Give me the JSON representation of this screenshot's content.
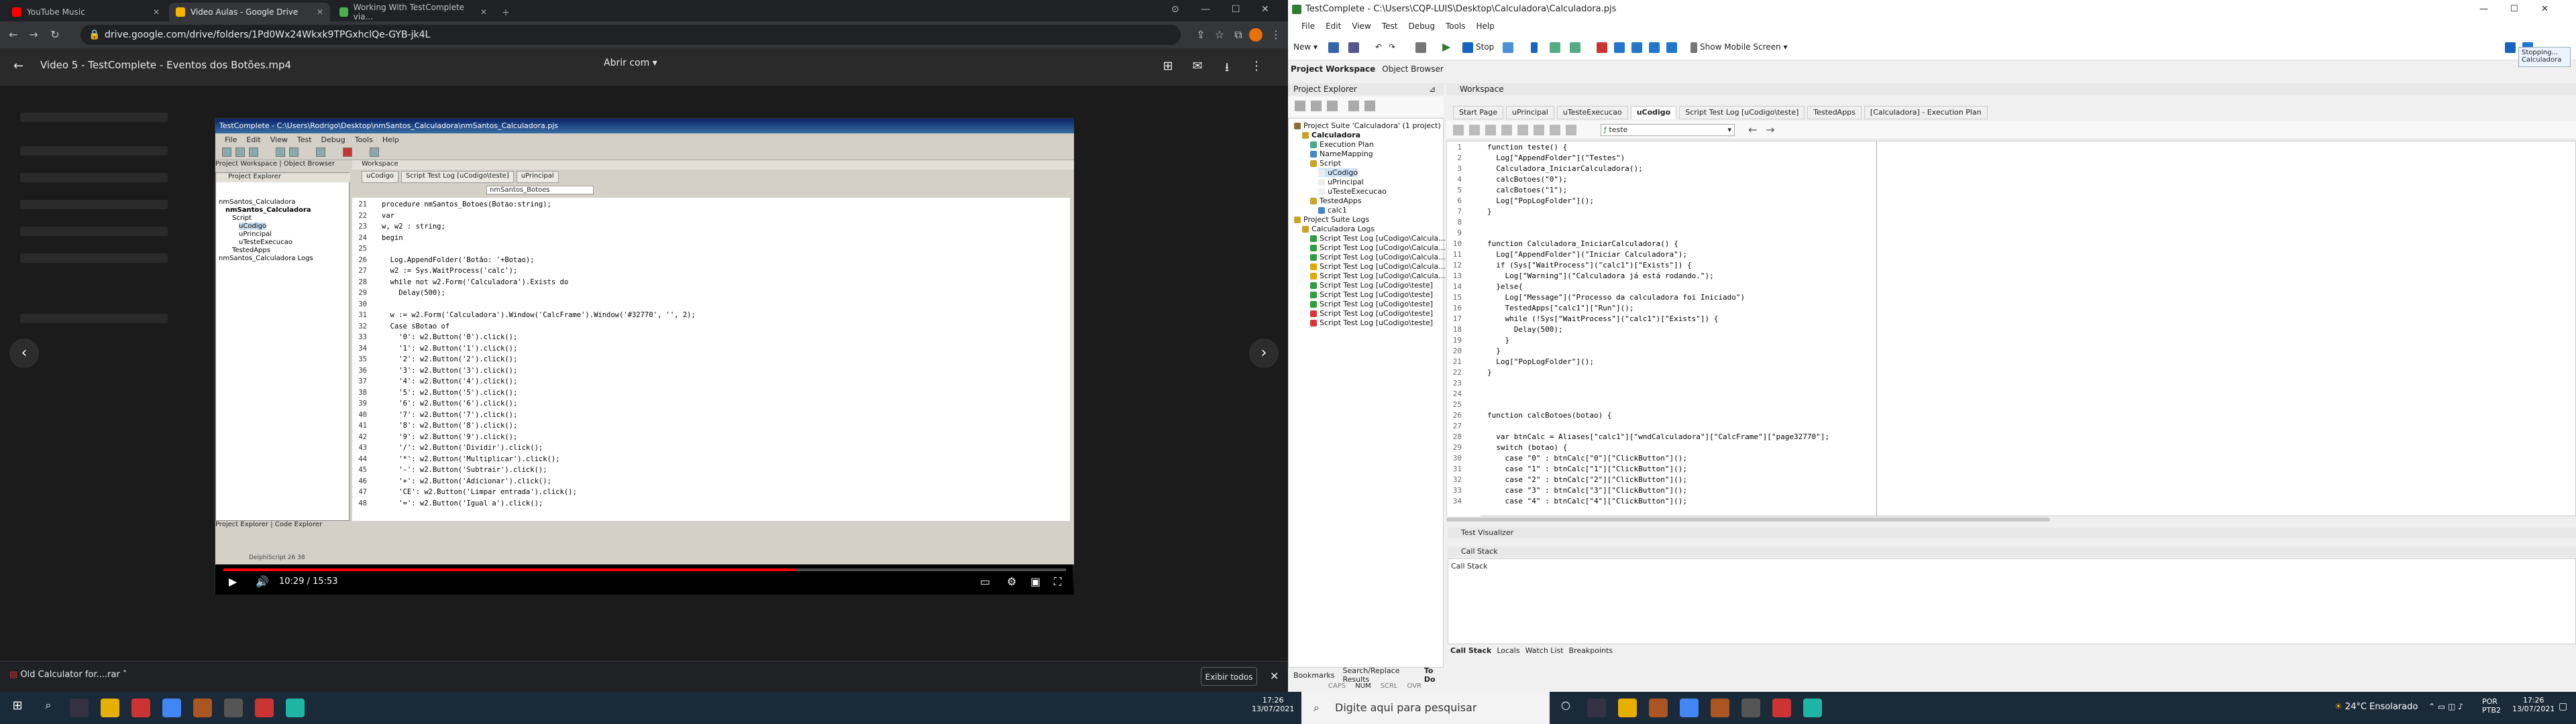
{
  "chrome": {
    "tabs": [
      {
        "label": "YouTube Music",
        "color": "#ff0000"
      },
      {
        "label": "Video Aulas - Google Drive",
        "color": "#f4b400"
      },
      {
        "label": "Working With TestComplete via...",
        "color": "#4caf50"
      }
    ],
    "address": "drive.google.com/drive/folders/1Pd0Wx24Wkxk9TPGxhclQe-GYB-jk4L",
    "video_title": "Video 5 - TestComplete - Eventos dos Botões.mp4",
    "open_with": "Abrir com"
  },
  "video": {
    "app_title": "TestComplete - C:\\Users\\Rodrigo\\Desktop\\nmSantos_Calculadora\\nmSantos_Calculadora.pjs",
    "menu": [
      "File",
      "Edit",
      "View",
      "Test",
      "Debug",
      "Tools",
      "Help"
    ],
    "left_tabs": [
      "Project Workspace",
      "Object Browser"
    ],
    "explorer_title": "Project Explorer",
    "tree": [
      "nmSantos_Calculadora",
      "nmSantos_Calculadora",
      "Script",
      "uCodigo",
      "uPrincipal",
      "uTesteExecucao",
      "TestedApps",
      "nmSantos_Calculadora Logs"
    ],
    "workspace_title": "Workspace",
    "tabs": [
      "uCodigo",
      "Script Test Log [uCodigo\\teste]",
      "uPrincipal"
    ],
    "routine": "nmSantos_Botoes",
    "code": [
      {
        "n": "21",
        "t": "procedure nmSantos_Botoes(Botao:string);"
      },
      {
        "n": "22",
        "t": "var"
      },
      {
        "n": "23",
        "t": "w, w2 : string;"
      },
      {
        "n": "24",
        "t": "begin"
      },
      {
        "n": "25",
        "t": ""
      },
      {
        "n": "26",
        "t": "  Log.AppendFolder('Botão: '+Botao);"
      },
      {
        "n": "27",
        "t": "  w2 := Sys.WaitProcess('calc');"
      },
      {
        "n": "28",
        "t": "  while not w2.Form('Calculadora').Exists do"
      },
      {
        "n": "29",
        "t": "    Delay(500);"
      },
      {
        "n": "30",
        "t": ""
      },
      {
        "n": "31",
        "t": "  w := w2.Form('Calculadora').Window('CalcFrame').Window('#32770', '', 2);"
      },
      {
        "n": "32",
        "t": "  Case sBotao of"
      },
      {
        "n": "33",
        "t": "    '0': w2.Button('0').click();"
      },
      {
        "n": "34",
        "t": "    '1': w2.Button('1').click();"
      },
      {
        "n": "35",
        "t": "    '2': w2.Button('2').click();"
      },
      {
        "n": "36",
        "t": "    '3': w2.Button('3').click();"
      },
      {
        "n": "37",
        "t": "    '4': w2.Button('4').click();"
      },
      {
        "n": "38",
        "t": "    '5': w2.Button('5').click();"
      },
      {
        "n": "39",
        "t": "    '6': w2.Button('6').click();"
      },
      {
        "n": "40",
        "t": "    '7': w2.Button('7').click();"
      },
      {
        "n": "41",
        "t": "    '8': w2.Button('8').click();"
      },
      {
        "n": "42",
        "t": "    '9': w2.Button('9').click();"
      },
      {
        "n": "43",
        "t": "    '/': w2.Button('Dividir').click();"
      },
      {
        "n": "44",
        "t": "    '*': w2.Button('Multiplicar').click();"
      },
      {
        "n": "45",
        "t": "    '-': w2.Button('Subtrair').click();"
      },
      {
        "n": "46",
        "t": "    '+': w2.Button('Adicionar').click();"
      },
      {
        "n": "47",
        "t": "    'CE': w2.Button('Limpar entrada').click();"
      },
      {
        "n": "48",
        "t": "    '=': w2.Button('Igual a').click();"
      }
    ],
    "bottom_tabs": [
      "Project Explorer",
      "Code Explorer"
    ],
    "status": "DelphiScript   26   38",
    "time": "10:29 / 15:53",
    "progress": 0.68
  },
  "download": {
    "file": "Old Calculator for....rar",
    "show_all": "Exibir todos"
  },
  "tc": {
    "title": "TestComplete - C:\\Users\\CQP-LUIS\\Desktop\\Calculadora\\Calculadora.pjs",
    "menu": [
      "File",
      "Edit",
      "View",
      "Test",
      "Debug",
      "Tools",
      "Help"
    ],
    "toolbar": {
      "new": "New",
      "stop": "Stop",
      "mobile": "Show Mobile Screen"
    },
    "subtabs": [
      "Project Workspace",
      "Object Browser"
    ],
    "explorer_title": "Project Explorer",
    "tree": [
      {
        "label": "Project Suite 'Calculadora' (1 project)",
        "lvl": 0,
        "c": "#8a6d3b"
      },
      {
        "label": "Calculadora",
        "lvl": 1,
        "c": "#c9a227",
        "b": true
      },
      {
        "label": "Execution Plan",
        "lvl": 2,
        "c": "#4a8"
      },
      {
        "label": "NameMapping",
        "lvl": 2,
        "c": "#48c"
      },
      {
        "label": "Script",
        "lvl": 2,
        "c": "#c9a227"
      },
      {
        "label": "uCodigo",
        "lvl": 3,
        "c": "#eee",
        "sel": true
      },
      {
        "label": "uPrincipal",
        "lvl": 3,
        "c": "#eee"
      },
      {
        "label": "uTesteExecucao",
        "lvl": 3,
        "c": "#eee"
      },
      {
        "label": "TestedApps",
        "lvl": 2,
        "c": "#c9a227"
      },
      {
        "label": "calc1",
        "lvl": 3,
        "c": "#48c"
      },
      {
        "label": "Project Suite Logs",
        "lvl": 0,
        "c": "#c9a227"
      },
      {
        "label": "Calculadora Logs",
        "lvl": 1,
        "c": "#c9a227"
      },
      {
        "label": "Script Test Log [uCodigo\\Calcula...",
        "lvl": 2,
        "c": "#2e9e3e"
      },
      {
        "label": "Script Test Log [uCodigo\\Calcula...",
        "lvl": 2,
        "c": "#2e9e3e"
      },
      {
        "label": "Script Test Log [uCodigo\\Calcula...",
        "lvl": 2,
        "c": "#2e9e3e"
      },
      {
        "label": "Script Test Log [uCodigo\\Calcula...",
        "lvl": 2,
        "c": "#e0a800"
      },
      {
        "label": "Script Test Log [uCodigo\\Calcula...",
        "lvl": 2,
        "c": "#e0a800"
      },
      {
        "label": "Script Test Log [uCodigo\\teste]",
        "lvl": 2,
        "c": "#2e9e3e"
      },
      {
        "label": "Script Test Log [uCodigo\\teste]",
        "lvl": 2,
        "c": "#2e9e3e"
      },
      {
        "label": "Script Test Log [uCodigo\\teste]",
        "lvl": 2,
        "c": "#2e9e3e"
      },
      {
        "label": "Script Test Log [uCodigo\\teste]",
        "lvl": 2,
        "c": "#d33"
      },
      {
        "label": "Script Test Log [uCodigo\\teste]",
        "lvl": 2,
        "c": "#d33"
      }
    ],
    "explorer_bottom": [
      "Bookmarks",
      "Search/Replace Results",
      "To Do"
    ],
    "workspace_title": "Workspace",
    "tabs": [
      "Start Page",
      "uPrincipal",
      "uTesteExecucao",
      "uCodigo",
      "Script Test Log [uCodigo\\teste]",
      "TestedApps",
      "[Calculadora] - Execution Plan"
    ],
    "active_tab": 3,
    "routine": "teste",
    "code": [
      {
        "n": "1",
        "t": "function teste() {"
      },
      {
        "n": "2",
        "t": "  Log[\"AppendFolder\"](\"Testes\")"
      },
      {
        "n": "3",
        "t": "  Calculadora_IniciarCalculadora();"
      },
      {
        "n": "4",
        "t": "  calcBotoes(\"0\");"
      },
      {
        "n": "5",
        "t": "  calcBotoes(\"1\");"
      },
      {
        "n": "6",
        "t": "  Log[\"PopLogFolder\"]();"
      },
      {
        "n": "7",
        "t": "}"
      },
      {
        "n": "8",
        "t": ""
      },
      {
        "n": "9",
        "t": ""
      },
      {
        "n": "10",
        "t": "function Calculadora_IniciarCalculadora() {"
      },
      {
        "n": "11",
        "t": "  Log[\"AppendFolder\"](\"Iniciar Calculadora\");"
      },
      {
        "n": "12",
        "t": "  if (Sys[\"WaitProcess\"](\"calc1\")[\"Exists\"]) {"
      },
      {
        "n": "13",
        "t": "    Log[\"Warning\"](\"Calculadora já está rodando.\");"
      },
      {
        "n": "14",
        "t": "  }else{"
      },
      {
        "n": "15",
        "t": "    Log[\"Message\"](\"Processo da calculadora foi Iniciado\")"
      },
      {
        "n": "16",
        "t": "    TestedApps[\"calc1\"][\"Run\"]();"
      },
      {
        "n": "17",
        "t": "    while (!Sys[\"WaitProcess\"](\"calc1\")[\"Exists\"]) {"
      },
      {
        "n": "18",
        "t": "      Delay(500);"
      },
      {
        "n": "19",
        "t": "    }"
      },
      {
        "n": "20",
        "t": "  }"
      },
      {
        "n": "21",
        "t": "  Log[\"PopLogFolder\"]();"
      },
      {
        "n": "22",
        "t": "}"
      },
      {
        "n": "23",
        "t": ""
      },
      {
        "n": "24",
        "t": ""
      },
      {
        "n": "25",
        "t": ""
      },
      {
        "n": "26",
        "t": "function calcBotoes(botao) {"
      },
      {
        "n": "27",
        "t": ""
      },
      {
        "n": "28",
        "t": "  var btnCalc = Aliases[\"calc1\"][\"wndCalculadora\"][\"CalcFrame\"][\"page32770\"];"
      },
      {
        "n": "29",
        "t": "  switch (botao) {"
      },
      {
        "n": "30",
        "t": "    case \"0\" : btnCalc[\"0\"][\"ClickButton\"]();"
      },
      {
        "n": "31",
        "t": "    case \"1\" : btnCalc[\"1\"][\"ClickButton\"]();"
      },
      {
        "n": "32",
        "t": "    case \"2\" : btnCalc[\"2\"][\"ClickButton\"]();"
      },
      {
        "n": "33",
        "t": "    case \"3\" : btnCalc[\"3\"][\"ClickButton\"]();"
      },
      {
        "n": "34",
        "t": "    case \"4\" : btnCalc[\"4\"][\"ClickButton\"]();"
      }
    ],
    "test_visualizer": "Test Visualizer",
    "call_stack": "Call Stack",
    "call_stack_col": "Call Stack",
    "bottom_tabs": [
      "Call Stack",
      "Locals",
      "Watch List",
      "Breakpoints"
    ],
    "status": [
      "CAPS",
      "NUM",
      "SCRL",
      "OVR"
    ],
    "stopping": [
      "Stopping...",
      "Calculadora"
    ]
  },
  "taskbar": {
    "search_placeholder": "Digite aqui para pesquisar",
    "weather": "24°C  Ensolarado",
    "lang": "POR PTB2",
    "time": "17:26",
    "date": "13/07/2021",
    "time_left": "17:26",
    "date_left": "13/07/2021"
  }
}
